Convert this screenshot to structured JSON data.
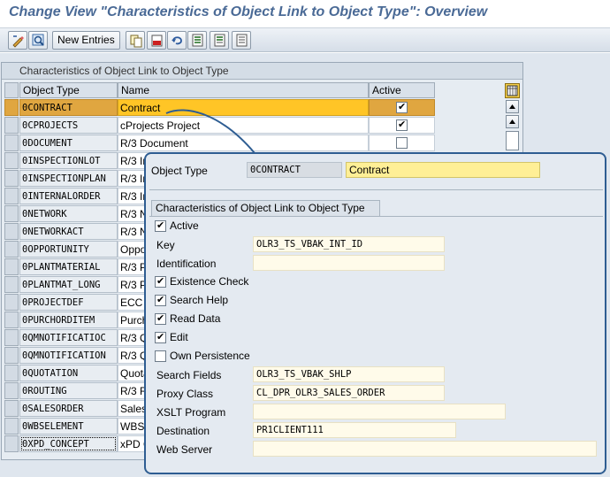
{
  "window": {
    "title": "Change View \"Characteristics of Object Link to Object Type\": Overview"
  },
  "toolbar": {
    "new_entries_label": "New Entries",
    "icons": [
      "display-change-icon",
      "find-icon",
      "copy-icon",
      "delete-icon",
      "undo-icon",
      "select-all-icon",
      "select-block-icon",
      "deselect-all-icon"
    ]
  },
  "table": {
    "title": "Characteristics of Object Link to Object Type",
    "col_object_type": "Object Type",
    "col_name": "Name",
    "col_active": "Active",
    "rows": [
      {
        "object_type": "0CONTRACT",
        "name": "Contract",
        "active": true,
        "selected": true
      },
      {
        "object_type": "0CPROJECTS",
        "name": "cProjects Project",
        "active": true
      },
      {
        "object_type": "0DOCUMENT",
        "name": "R/3 Document",
        "active": false
      },
      {
        "object_type": "0INSPECTIONLOT",
        "name": "R/3 In"
      },
      {
        "object_type": "0INSPECTIONPLAN",
        "name": "R/3 In"
      },
      {
        "object_type": "0INTERNALORDER",
        "name": "R/3 In"
      },
      {
        "object_type": "0NETWORK",
        "name": "R/3 N"
      },
      {
        "object_type": "0NETWORKACT",
        "name": "R/3 N"
      },
      {
        "object_type": "0OPPORTUNITY",
        "name": "Oppo"
      },
      {
        "object_type": "0PLANTMATERIAL",
        "name": "R/3 P"
      },
      {
        "object_type": "0PLANTMAT_LONG",
        "name": "R/3 P"
      },
      {
        "object_type": "0PROJECTDEF",
        "name": "ECC"
      },
      {
        "object_type": "0PURCHORDITEM",
        "name": "Purch"
      },
      {
        "object_type": "0QMNOTIFICATIOC",
        "name": "R/3 Q"
      },
      {
        "object_type": "0QMNOTIFICATION",
        "name": "R/3 Q"
      },
      {
        "object_type": "0QUOTATION",
        "name": "Quota"
      },
      {
        "object_type": "0ROUTING",
        "name": "R/3 R"
      },
      {
        "object_type": "0SALESORDER",
        "name": "Sales"
      },
      {
        "object_type": "0WBSELEMENT",
        "name": "WBS"
      },
      {
        "object_type": "0XPD_CONCEPT",
        "name": "xPD C"
      }
    ]
  },
  "detail": {
    "object_type_label": "Object Type",
    "object_type_value": "0CONTRACT",
    "name_value": "Contract",
    "group_title": "Characteristics of Object Link to Object Type",
    "active_label": "Active",
    "active_checked": true,
    "key_label": "Key",
    "key_value": "OLR3_TS_VBAK_INT_ID",
    "identification_label": "Identification",
    "identification_value": "",
    "existence_check_label": "Existence Check",
    "existence_check_checked": true,
    "search_help_label": "Search Help",
    "search_help_checked": true,
    "read_data_label": "Read Data",
    "read_data_checked": true,
    "edit_label": "Edit",
    "edit_checked": true,
    "own_persistence_label": "Own Persistence",
    "own_persistence_checked": false,
    "search_fields_label": "Search Fields",
    "search_fields_value": "OLR3_TS_VBAK_SHLP",
    "proxy_class_label": "Proxy Class",
    "proxy_class_value": "CL_DPR_OLR3_SALES_ORDER",
    "xslt_program_label": "XSLT Program",
    "xslt_program_value": "",
    "destination_label": "Destination",
    "destination_value": "PR1CLIENT111",
    "web_server_label": "Web Server",
    "web_server_value": ""
  },
  "colors": {
    "title": "#4a6a96",
    "selected_row": "#ffc526",
    "callout_border": "#2e5d92"
  }
}
